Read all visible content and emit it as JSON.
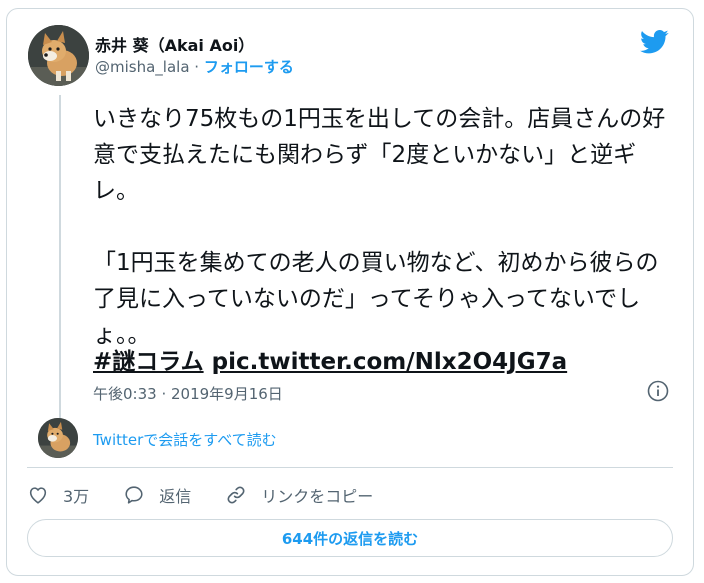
{
  "author": {
    "display_name": "赤井 葵（Akai Aoi）",
    "handle": "@misha_lala",
    "separator": " · ",
    "follow_label": "フォローする"
  },
  "tweet": {
    "text": "いきなり75枚もの1円玉を出しての会計。店員さんの好意で支払えたにも関わらず「2度といかない」と逆ギレ。\n\n「1円玉を集めての老人の買い物など、初めから彼らの了見に入っていないのだ」ってそりゃ入ってないでしょ。。",
    "hashtag": "#謎コラム",
    "link": "pic.twitter.com/Nlx2O4JG7a",
    "timestamp": "午後0:33 · 2019年9月16日"
  },
  "thread": {
    "read_all_label": "Twitterで会話をすべて読む"
  },
  "actions": {
    "like_count": "3万",
    "reply_label": "返信",
    "copy_link_label": "リンクをコピー"
  },
  "replies_button": {
    "label": "644件の返信を読む"
  },
  "icons": {
    "logo": "twitter-bird-icon",
    "info": "info-icon",
    "like": "heart-icon",
    "reply": "speech-bubble-icon",
    "copy": "link-icon"
  },
  "colors": {
    "accent": "#1d9bf0",
    "text": "#0f1419",
    "muted": "#536471",
    "border": "#cfd9de"
  }
}
